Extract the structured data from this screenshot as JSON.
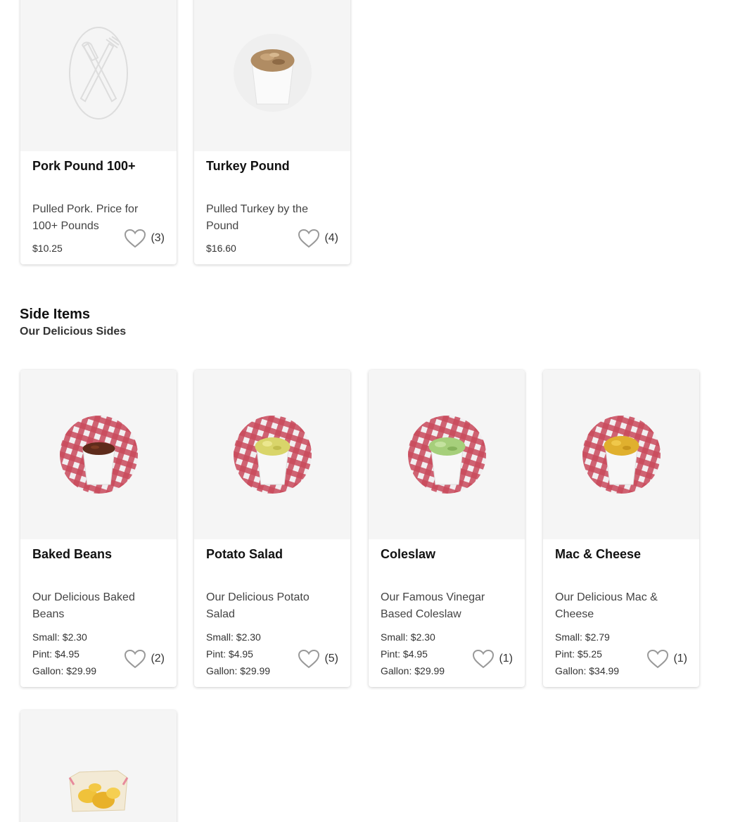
{
  "top_items": [
    {
      "name": "Pork Pound 100+",
      "description": "Pulled Pork. Price for 100+ Pounds",
      "price": "$10.25",
      "likes": "(3)",
      "image": "placeholder-utensils-icon"
    },
    {
      "name": "Turkey Pound",
      "description": "Pulled Turkey by the Pound",
      "price": "$16.60",
      "likes": "(4)",
      "image": "pulled-turkey-cup"
    }
  ],
  "sides_section": {
    "title": "Side Items",
    "subtitle": "Our Delicious Sides"
  },
  "side_items": [
    {
      "name": "Baked Beans",
      "description": "Our Delicious Baked Beans",
      "prices": [
        "Small: $2.30",
        "Pint: $4.95",
        "Gallon: $29.99"
      ],
      "likes": "(2)",
      "image": "baked-beans-cup"
    },
    {
      "name": "Potato Salad",
      "description": "Our Delicious Potato Salad",
      "prices": [
        "Small: $2.30",
        "Pint: $4.95",
        "Gallon: $29.99"
      ],
      "likes": "(5)",
      "image": "potato-salad-cup"
    },
    {
      "name": "Coleslaw",
      "description": "Our Famous Vinegar Based Coleslaw",
      "prices": [
        "Small: $2.30",
        "Pint: $4.95",
        "Gallon: $29.99"
      ],
      "likes": "(1)",
      "image": "coleslaw-cup"
    },
    {
      "name": "Mac & Cheese",
      "description": "Our Delicious Mac & Cheese",
      "prices": [
        "Small: $2.79",
        "Pint: $5.25",
        "Gallon: $34.99"
      ],
      "likes": "(1)",
      "image": "mac-and-cheese-cup"
    }
  ],
  "partial_item": {
    "image": "chips-bag"
  },
  "colors": {
    "card_image_bg": "#f5f5f5",
    "heart_outline": "#999999",
    "tablecloth_red": "#c94a5c"
  }
}
